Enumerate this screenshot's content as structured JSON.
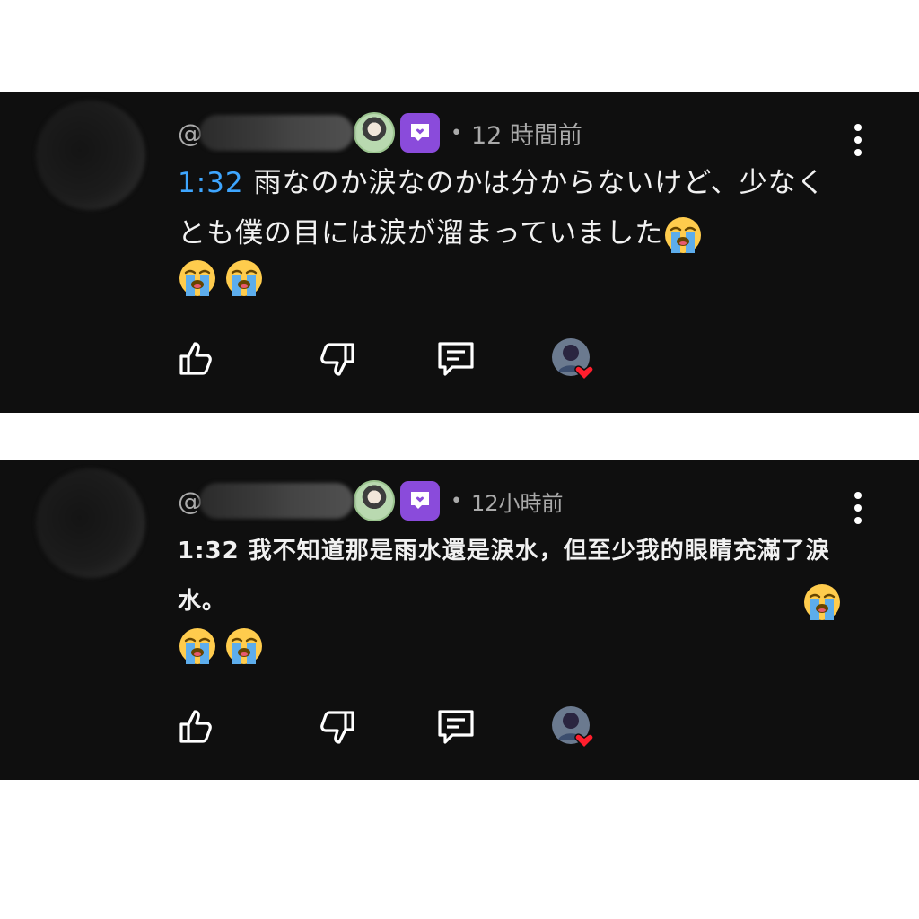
{
  "comments": [
    {
      "handle_prefix": "@",
      "time": "12 時間前",
      "timestamp": "1:32",
      "text": " 雨なのか涙なのかは分からないけど、少なくとも僕の目には涙が溜まっていました",
      "emoji": "😭",
      "emoji_after_text": 1,
      "emoji_line_count": 2
    },
    {
      "handle_prefix": "@",
      "time": "12小時前",
      "timestamp": "1:32",
      "text": " 我不知道那是雨水還是淚水，但至少我的眼睛充滿了淚水。",
      "emoji": "😭",
      "emoji_after_text": 1,
      "emoji_line_count": 2
    }
  ],
  "icons": [
    "like-icon",
    "dislike-icon",
    "reply-icon",
    "creator-heart-icon",
    "more-vert-icon",
    "member-badge-icon"
  ],
  "colors": {
    "background": "#0f0f0f",
    "timestamp_link": "#3ea6ff",
    "badge": "#8a4bdb",
    "heart": "#ff1e2d"
  }
}
